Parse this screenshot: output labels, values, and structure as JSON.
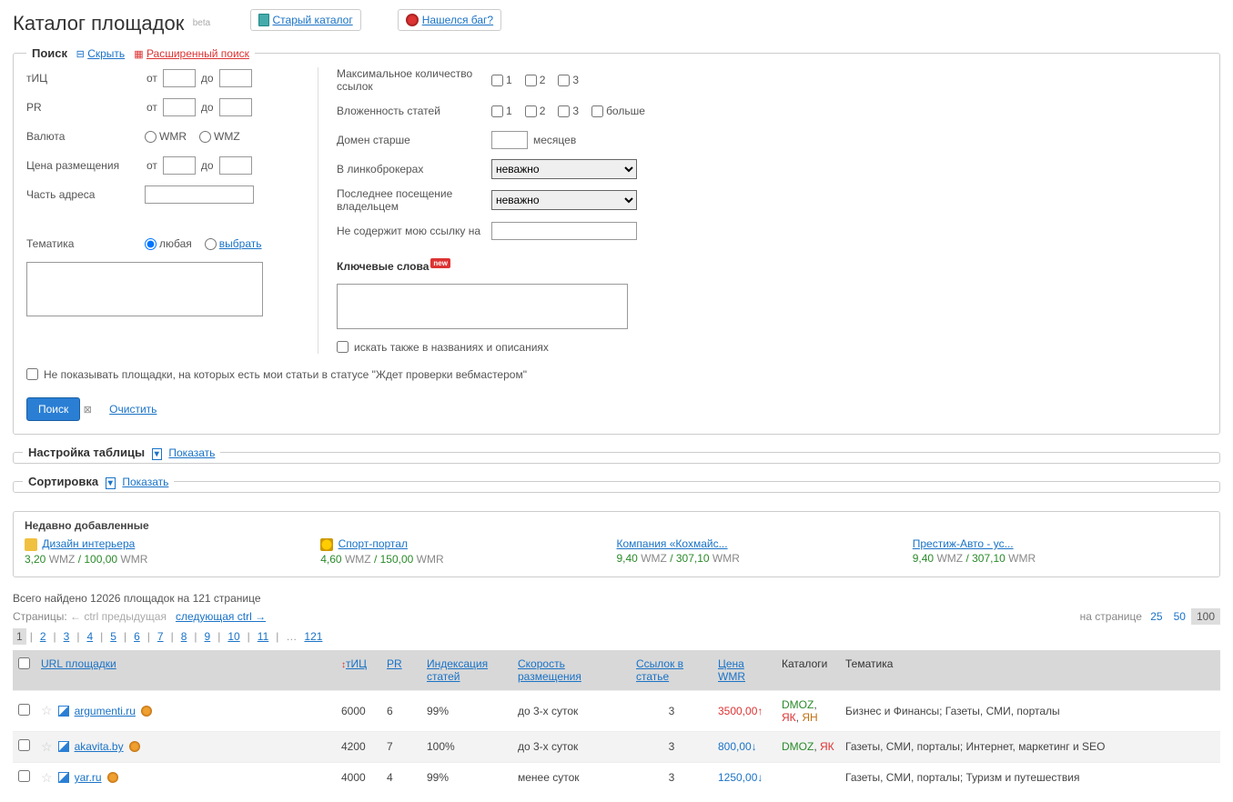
{
  "header": {
    "title": "Каталог площадок",
    "beta": "beta",
    "oldCatalog": "Старый каталог",
    "bugLink": "Нашелся баг?"
  },
  "search": {
    "legend": "Поиск",
    "hideLink": "Скрыть",
    "advLink": "Расширенный поиск",
    "labels": {
      "tic": "тИЦ",
      "pr": "PR",
      "currency": "Валюта",
      "price": "Цена размещения",
      "urlPart": "Часть адреса",
      "topic": "Тематика",
      "from": "от",
      "to": "до",
      "wmr": "WMR",
      "wmz": "WMZ",
      "any": "любая",
      "select": "выбрать",
      "maxLinks": "Максимальное количество ссылок",
      "nesting": "Вложенность статей",
      "domainAge": "Домен старше",
      "months": "месяцев",
      "linkBrokers": "В линкоброкерах",
      "lastVisit": "Последнее посещение владельцем",
      "noMyLink": "Не содержит мою ссылку на",
      "keywords": "Ключевые слова",
      "searchAlso": "искать также в названиях и описаниях",
      "more": "больше",
      "noShowPending": "Не показывать площадки, на которых есть мои статьи в статусе \"Ждет проверки вебмастером\"",
      "newBadge": "new"
    },
    "selects": {
      "linkBrokers": "неважно",
      "lastVisit": "неважно"
    },
    "nums": {
      "n1": "1",
      "n2": "2",
      "n3": "3"
    },
    "btnSearch": "Поиск",
    "clearLink": "Очистить"
  },
  "sections": {
    "tableSettings": "Настройка таблицы",
    "sorting": "Сортировка",
    "show": "Показать"
  },
  "recent": {
    "title": "Недавно добавленные",
    "items": [
      {
        "name": "Дизайн интерьера",
        "wmz": "3,20",
        "wmr": "100,00"
      },
      {
        "name": "Спорт-портал",
        "wmz": "4,60",
        "wmr": "150,00"
      },
      {
        "name": "Компания «Кохмайс...",
        "wmz": "9,40",
        "wmr": "307,10"
      },
      {
        "name": "Престиж-Авто - ус...",
        "wmz": "9,40",
        "wmr": "307,10"
      }
    ],
    "wmzLabel": "WMZ",
    "wmrLabel": "WMR",
    "sep": " / "
  },
  "summary": {
    "total": "Всего найдено 12026 площадок на 121 странице",
    "pagesLabel": "Страницы:",
    "prev": "← ctrl предыдущая",
    "next": "следующая ctrl →",
    "perPageLabel": "на странице",
    "perPage": [
      "25",
      "50",
      "100"
    ],
    "perPageActive": "100",
    "pages": [
      "1",
      "2",
      "3",
      "4",
      "5",
      "6",
      "7",
      "8",
      "9",
      "10",
      "11"
    ],
    "ellipsis": "…",
    "last": "121"
  },
  "table": {
    "headers": {
      "url": "URL площадки",
      "tic": "тИЦ",
      "pr": "PR",
      "indexing": "Индексация статей",
      "speed": "Скорость размещения",
      "linksIn": "Ссылок в статье",
      "price": "Цена WMR",
      "catalogs": "Каталоги",
      "topics": "Тематика"
    },
    "rows": [
      {
        "url": "argumenti.ru",
        "tic": "6000",
        "pr": "6",
        "idx": "99%",
        "speed": "до 3-х суток",
        "links": "3",
        "price": "3500,00",
        "dir": "up",
        "cats": [
          [
            "DMOZ",
            "dmoz"
          ],
          [
            "ЯК",
            "yak"
          ],
          [
            "ЯН",
            "yan"
          ]
        ],
        "topics": "Бизнес и Финансы; Газеты, СМИ, порталы"
      },
      {
        "url": "akavita.by",
        "tic": "4200",
        "pr": "7",
        "idx": "100%",
        "speed": "до 3-х суток",
        "links": "3",
        "price": "800,00",
        "dir": "down",
        "cats": [
          [
            "DMOZ",
            "dmoz"
          ],
          [
            "ЯК",
            "yak"
          ]
        ],
        "topics": "Газеты, СМИ, порталы; Интернет, маркетинг и SEO"
      },
      {
        "url": "yar.ru",
        "tic": "4000",
        "pr": "4",
        "idx": "99%",
        "speed": "менее суток",
        "links": "3",
        "price": "1250,00",
        "dir": "down",
        "cats": [],
        "topics": "Газеты, СМИ, порталы; Туризм и путешествия"
      }
    ]
  }
}
